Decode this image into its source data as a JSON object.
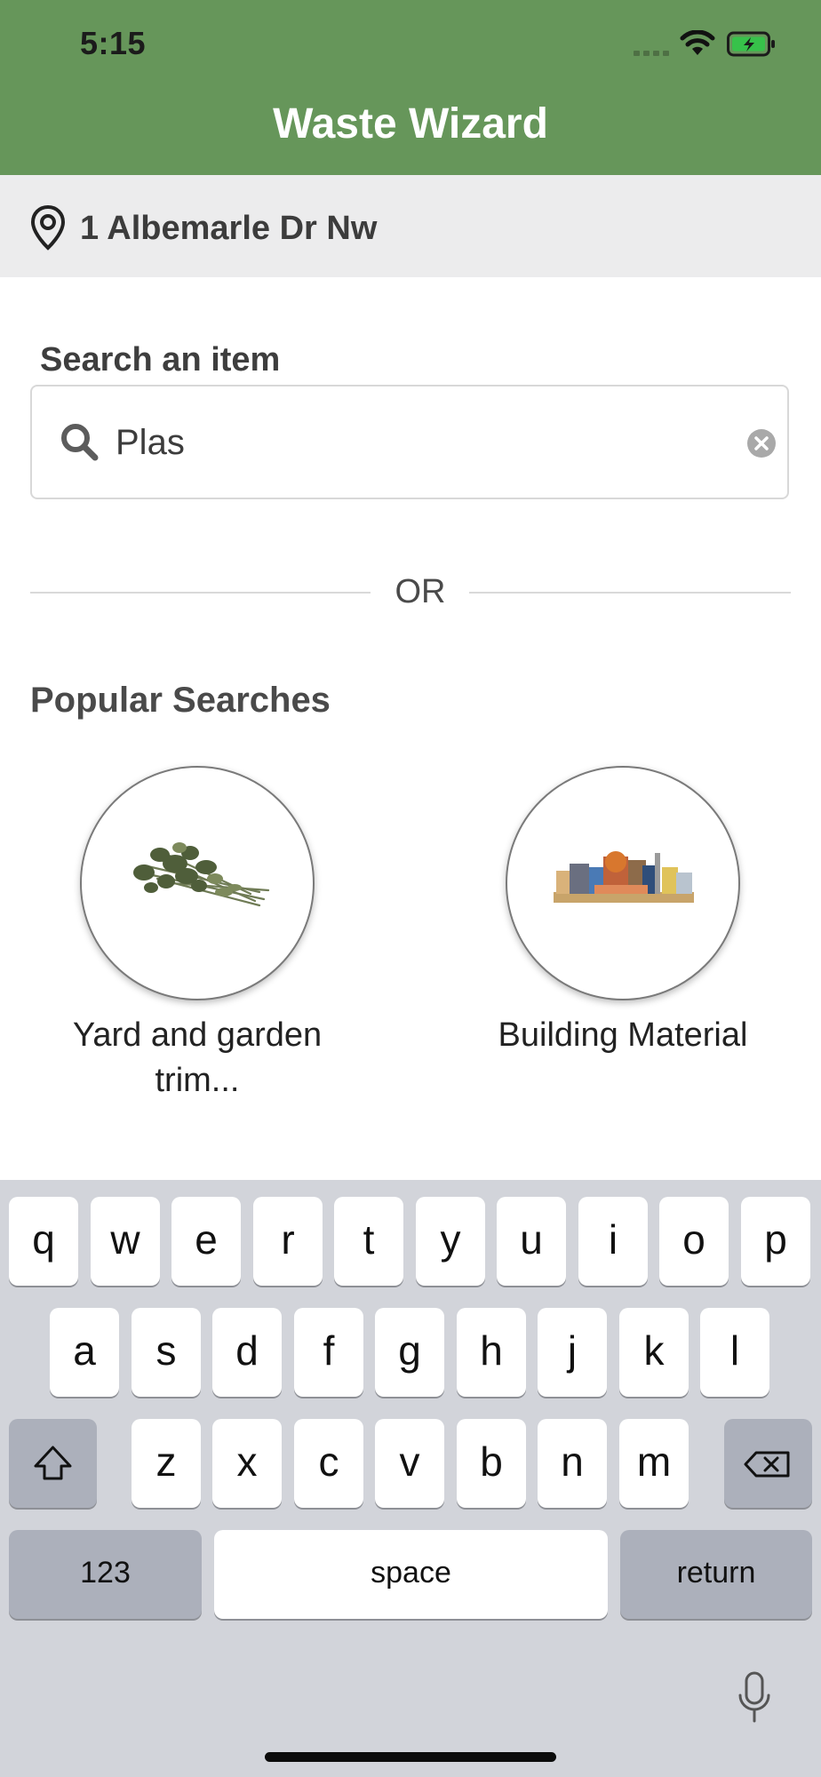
{
  "status_bar": {
    "time": "5:15"
  },
  "header": {
    "title": "Waste Wizard"
  },
  "location": {
    "address": "1 Albemarle Dr Nw"
  },
  "search": {
    "label": "Search an item",
    "value": "Plas"
  },
  "divider": {
    "text": "OR"
  },
  "popular": {
    "title": "Popular Searches",
    "items": [
      {
        "label": "Yard and garden trim...",
        "icon": "yard-trimmings-image"
      },
      {
        "label": "Building Material",
        "icon": "building-material-image"
      }
    ]
  },
  "keyboard": {
    "row1": [
      "q",
      "w",
      "e",
      "r",
      "t",
      "y",
      "u",
      "i",
      "o",
      "p"
    ],
    "row2": [
      "a",
      "s",
      "d",
      "f",
      "g",
      "h",
      "j",
      "k",
      "l"
    ],
    "row3": [
      "z",
      "x",
      "c",
      "v",
      "b",
      "n",
      "m"
    ],
    "numbers_label": "123",
    "space_label": "space",
    "return_label": "return"
  },
  "colors": {
    "header": "#66965a",
    "location_bar": "#ececed",
    "keyboard": "#d2d4da"
  }
}
